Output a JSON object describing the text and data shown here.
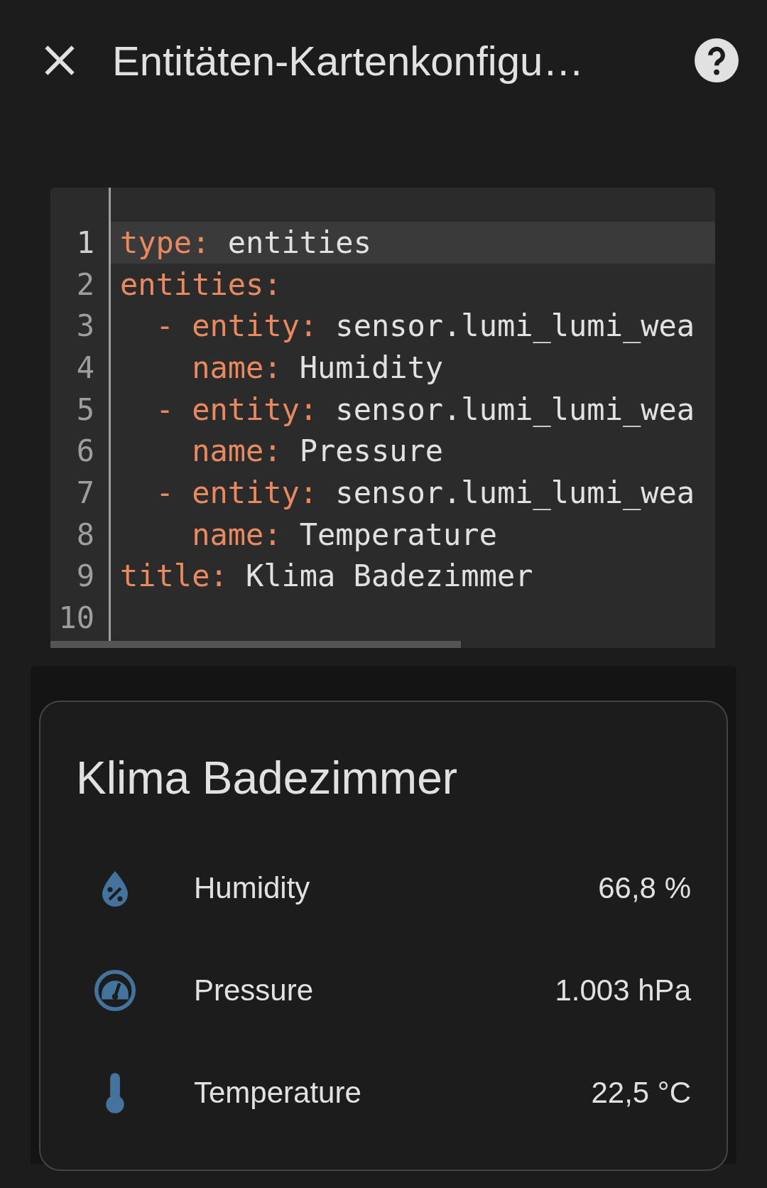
{
  "header": {
    "title": "Entitäten-Kartenkonfigu…"
  },
  "editor": {
    "lines": [
      {
        "number": "1",
        "key": "type:",
        "value": "entities",
        "active": true
      },
      {
        "number": "2",
        "key": "entities:",
        "active": false
      },
      {
        "number": "3",
        "key": "  - entity:",
        "value": "sensor.lumi_lumi_wea",
        "active": false
      },
      {
        "number": "4",
        "key": "    name:",
        "value": "Humidity",
        "active": false
      },
      {
        "number": "5",
        "key": "  - entity:",
        "value": "sensor.lumi_lumi_wea",
        "active": false
      },
      {
        "number": "6",
        "key": "    name:",
        "value": "Pressure",
        "active": false
      },
      {
        "number": "7",
        "key": "  - entity:",
        "value": "sensor.lumi_lumi_wea",
        "active": false
      },
      {
        "number": "8",
        "key": "    name:",
        "value": "Temperature",
        "active": false
      },
      {
        "number": "9",
        "key": "title:",
        "value": "Klima Badezimmer",
        "active": false
      },
      {
        "number": "10",
        "active": false
      }
    ]
  },
  "card": {
    "title": "Klima Badezimmer",
    "entities": [
      {
        "kind": "humidity",
        "name": "Humidity",
        "value": "66,8 %"
      },
      {
        "kind": "pressure",
        "name": "Pressure",
        "value": "1.003 hPa"
      },
      {
        "kind": "temperature",
        "name": "Temperature",
        "value": "22,5 °C"
      }
    ]
  }
}
